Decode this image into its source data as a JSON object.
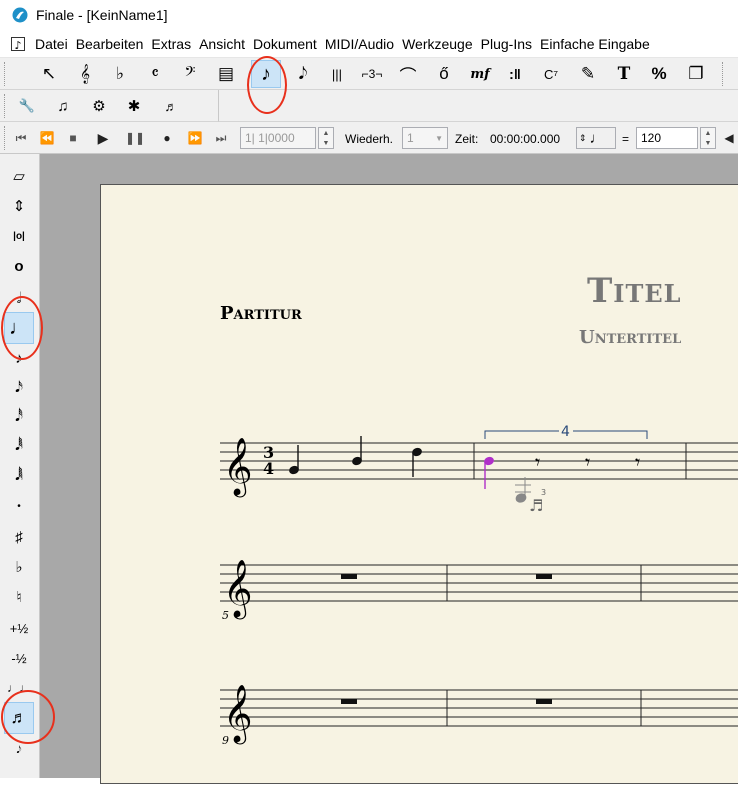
{
  "titlebar": {
    "title": "Finale  - [KeinName1]"
  },
  "menubar": {
    "items": [
      "Datei",
      "Bearbeiten",
      "Extras",
      "Ansicht",
      "Dokument",
      "MIDI/Audio",
      "Werkzeuge",
      "Plug-Ins",
      "Einfache Eingabe"
    ]
  },
  "main_toolbar": {
    "tools": [
      {
        "name": "selection-tool",
        "glyph": "↖"
      },
      {
        "name": "staff-tool",
        "glyph": "𝄞"
      },
      {
        "name": "key-signature-tool",
        "glyph": "♭"
      },
      {
        "name": "time-signature-tool",
        "glyph": "𝄴"
      },
      {
        "name": "clef-tool",
        "glyph": "𝄢"
      },
      {
        "name": "measure-tool",
        "glyph": "▤"
      },
      {
        "name": "simple-entry-tool",
        "glyph": "♪"
      },
      {
        "name": "speedy-entry-tool",
        "glyph": "𝅘𝅥𝅮"
      },
      {
        "name": "hyper-scribe-tool",
        "glyph": "|||"
      },
      {
        "name": "tuplet-tool",
        "glyph": "⌐3¬"
      },
      {
        "name": "smart-shape-tool",
        "glyph": "⌒"
      },
      {
        "name": "articulation-tool",
        "glyph": "ő"
      },
      {
        "name": "expression-tool",
        "glyph": "mf"
      },
      {
        "name": "repeat-tool",
        "glyph": ":‖"
      },
      {
        "name": "chord-tool",
        "glyph": "C⁷"
      },
      {
        "name": "lyrics-tool",
        "glyph": "✎"
      },
      {
        "name": "text-tool",
        "glyph": "T"
      },
      {
        "name": "resize-tool",
        "glyph": "%"
      },
      {
        "name": "page-layout-tool",
        "glyph": "❐"
      }
    ]
  },
  "secondary_toolbar": {
    "tools": [
      {
        "name": "wrench-icon",
        "glyph": "🔧"
      },
      {
        "name": "note-mover-icon",
        "glyph": "♫"
      },
      {
        "name": "special-tools-icon",
        "glyph": "⚙"
      },
      {
        "name": "mirror-tool-icon",
        "glyph": "✱"
      },
      {
        "name": "ossia-tool-icon",
        "glyph": "♬"
      }
    ]
  },
  "playback": {
    "measure_value": "1|  1|0000",
    "repeat_label": "Wiederh.",
    "repeat_value": "1",
    "time_label": "Zeit:",
    "time_value": "00:00:00.000",
    "equals": "=",
    "tempo_value": "120"
  },
  "left_palette": {
    "items": [
      {
        "name": "eraser-icon",
        "glyph": "▱"
      },
      {
        "name": "half-step-icon",
        "glyph": "⇕"
      },
      {
        "name": "double-whole-note-icon",
        "glyph": "|o|"
      },
      {
        "name": "whole-note-icon",
        "glyph": "o"
      },
      {
        "name": "half-note-icon",
        "glyph": "𝅗𝅥"
      },
      {
        "name": "quarter-note-icon",
        "glyph": "♩"
      },
      {
        "name": "eighth-note-icon",
        "glyph": "♪"
      },
      {
        "name": "sixteenth-note-icon",
        "glyph": "𝅘𝅥𝅯"
      },
      {
        "name": "thirty-second-note-icon",
        "glyph": "𝅘𝅥𝅰"
      },
      {
        "name": "sixty-fourth-note-icon",
        "glyph": "𝅘𝅥𝅱"
      },
      {
        "name": "hundred-twenty-eighth-note-icon",
        "glyph": "𝅘𝅥𝅲"
      },
      {
        "name": "dot-icon",
        "glyph": "•"
      },
      {
        "name": "sharp-icon",
        "glyph": "♯"
      },
      {
        "name": "flat-icon",
        "glyph": "♭"
      },
      {
        "name": "natural-icon",
        "glyph": "♮"
      },
      {
        "name": "half-step-up-icon",
        "glyph": "+½"
      },
      {
        "name": "half-step-down-icon",
        "glyph": "-½"
      },
      {
        "name": "tie-icon",
        "glyph": "♩♩"
      },
      {
        "name": "tuplet-icon",
        "glyph": "♬"
      },
      {
        "name": "grace-note-icon",
        "glyph": "𝆕"
      }
    ]
  },
  "score": {
    "title": "Titel",
    "subtitle": "Untertitel",
    "part_label": "Partitur",
    "time_sig_top": "3",
    "time_sig_bottom": "4",
    "tuplet_number": "4",
    "tuplet_cursor_small": "3",
    "measure_number_2": "5",
    "measure_number_3": "9",
    "selected_note_color": "#b02fc9",
    "annotation_color": "#e8301c",
    "tuplet_bracket_color": "#2a4a7a"
  }
}
